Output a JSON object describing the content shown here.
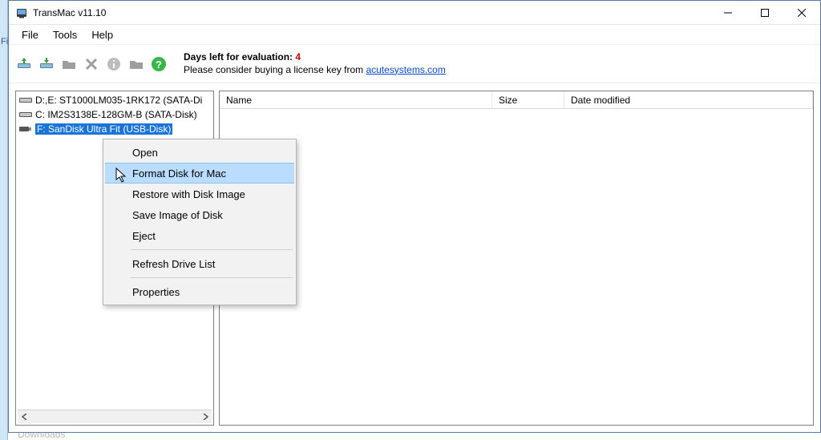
{
  "title": "TransMac v11.10",
  "menu": {
    "file": "File",
    "tools": "Tools",
    "help": "Help"
  },
  "toolbar": {
    "eval_days_label": "Days left for evaluation: ",
    "eval_days_num": "4",
    "eval_please": "Please consider buying a license key from ",
    "eval_link": "acutesystems.com"
  },
  "drives": [
    {
      "label": "D:,E:  ST1000LM035-1RK172 (SATA-Di"
    },
    {
      "label": "C:  IM2S3138E-128GM-B (SATA-Disk)"
    },
    {
      "label": "F: SanDisk Ultra Fit (USB-Disk)"
    }
  ],
  "columns": {
    "name": "Name",
    "size": "Size",
    "date": "Date modified"
  },
  "context_menu": {
    "open": "Open",
    "format": "Format Disk for Mac",
    "restore": "Restore with Disk Image",
    "save_image": "Save Image of Disk",
    "eject": "Eject",
    "refresh": "Refresh Drive List",
    "properties": "Properties"
  },
  "watermark": {
    "line1": "",
    "line2": ""
  },
  "bottom_peek": "Downloads"
}
